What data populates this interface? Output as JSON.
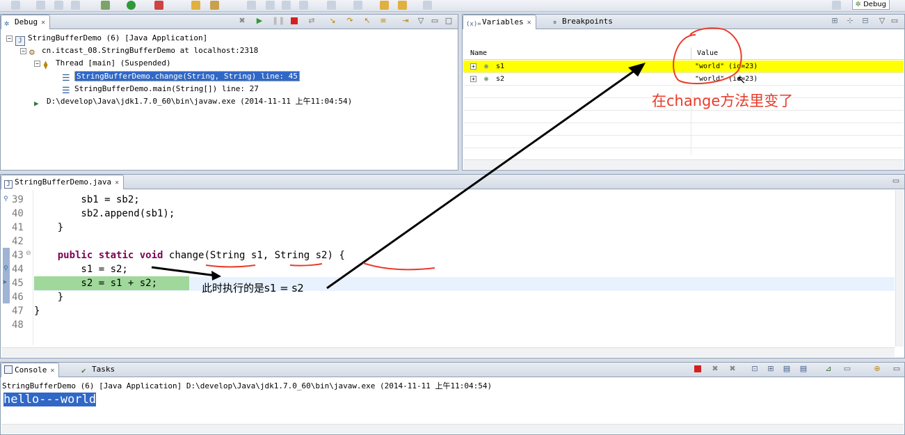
{
  "perspective_label": "Debug",
  "debug_view": {
    "tab_label": "Debug",
    "tree": [
      {
        "label": "StringBufferDemo (6) [Java Application]",
        "icon": "java-app-icon"
      },
      {
        "label": "cn.itcast_08.StringBufferDemo at localhost:2318",
        "icon": "debug-target-icon"
      },
      {
        "label": "Thread [main] (Suspended)",
        "icon": "thread-icon"
      },
      {
        "label": "StringBufferDemo.change(String, String) line: 45",
        "icon": "stack-frame-icon"
      },
      {
        "label": "StringBufferDemo.main(String[]) line: 27",
        "icon": "stack-frame-icon"
      },
      {
        "label": "D:\\develop\\Java\\jdk1.7.0_60\\bin\\javaw.exe (2014-11-11 上午11:04:54)",
        "icon": "process-icon"
      }
    ]
  },
  "variables_view": {
    "tabs": [
      "Variables",
      "Breakpoints"
    ],
    "columns": [
      "Name",
      "Value"
    ],
    "rows": [
      {
        "name": "s1",
        "value": "\"world\" (id=23)"
      },
      {
        "name": "s2",
        "value": "\"world\" (id=23)"
      }
    ],
    "annotation": "在change方法里变了",
    "annotation_color": "#e83b2a"
  },
  "editor": {
    "tab_label": "StringBufferDemo.java",
    "lines": [
      {
        "num": "39",
        "code": "        sb1 = sb2;"
      },
      {
        "num": "40",
        "code": "        sb2.append(sb1);"
      },
      {
        "num": "41",
        "code": "    }"
      },
      {
        "num": "42",
        "code": ""
      },
      {
        "num": "43",
        "code_parts": [
          "    ",
          "public",
          " ",
          "static",
          " ",
          "void",
          " change(String s1, String s2) {"
        ]
      },
      {
        "num": "44",
        "code": "        s1 = s2;"
      },
      {
        "num": "45",
        "code": "        s2 = s1 + s2;"
      },
      {
        "num": "46",
        "code": "    }"
      },
      {
        "num": "47",
        "code": "}"
      },
      {
        "num": "48",
        "code": ""
      }
    ],
    "annotation": "此时执行的是s1 = s2",
    "highlight_color": "#9fd89a",
    "keyword_color": "#7f0055"
  },
  "console_view": {
    "tabs": [
      "Console",
      "Tasks"
    ],
    "process_line": "StringBufferDemo (6) [Java Application] D:\\develop\\Java\\jdk1.7.0_60\\bin\\javaw.exe (2014-11-11 上午11:04:54)",
    "output": "hello---world"
  }
}
